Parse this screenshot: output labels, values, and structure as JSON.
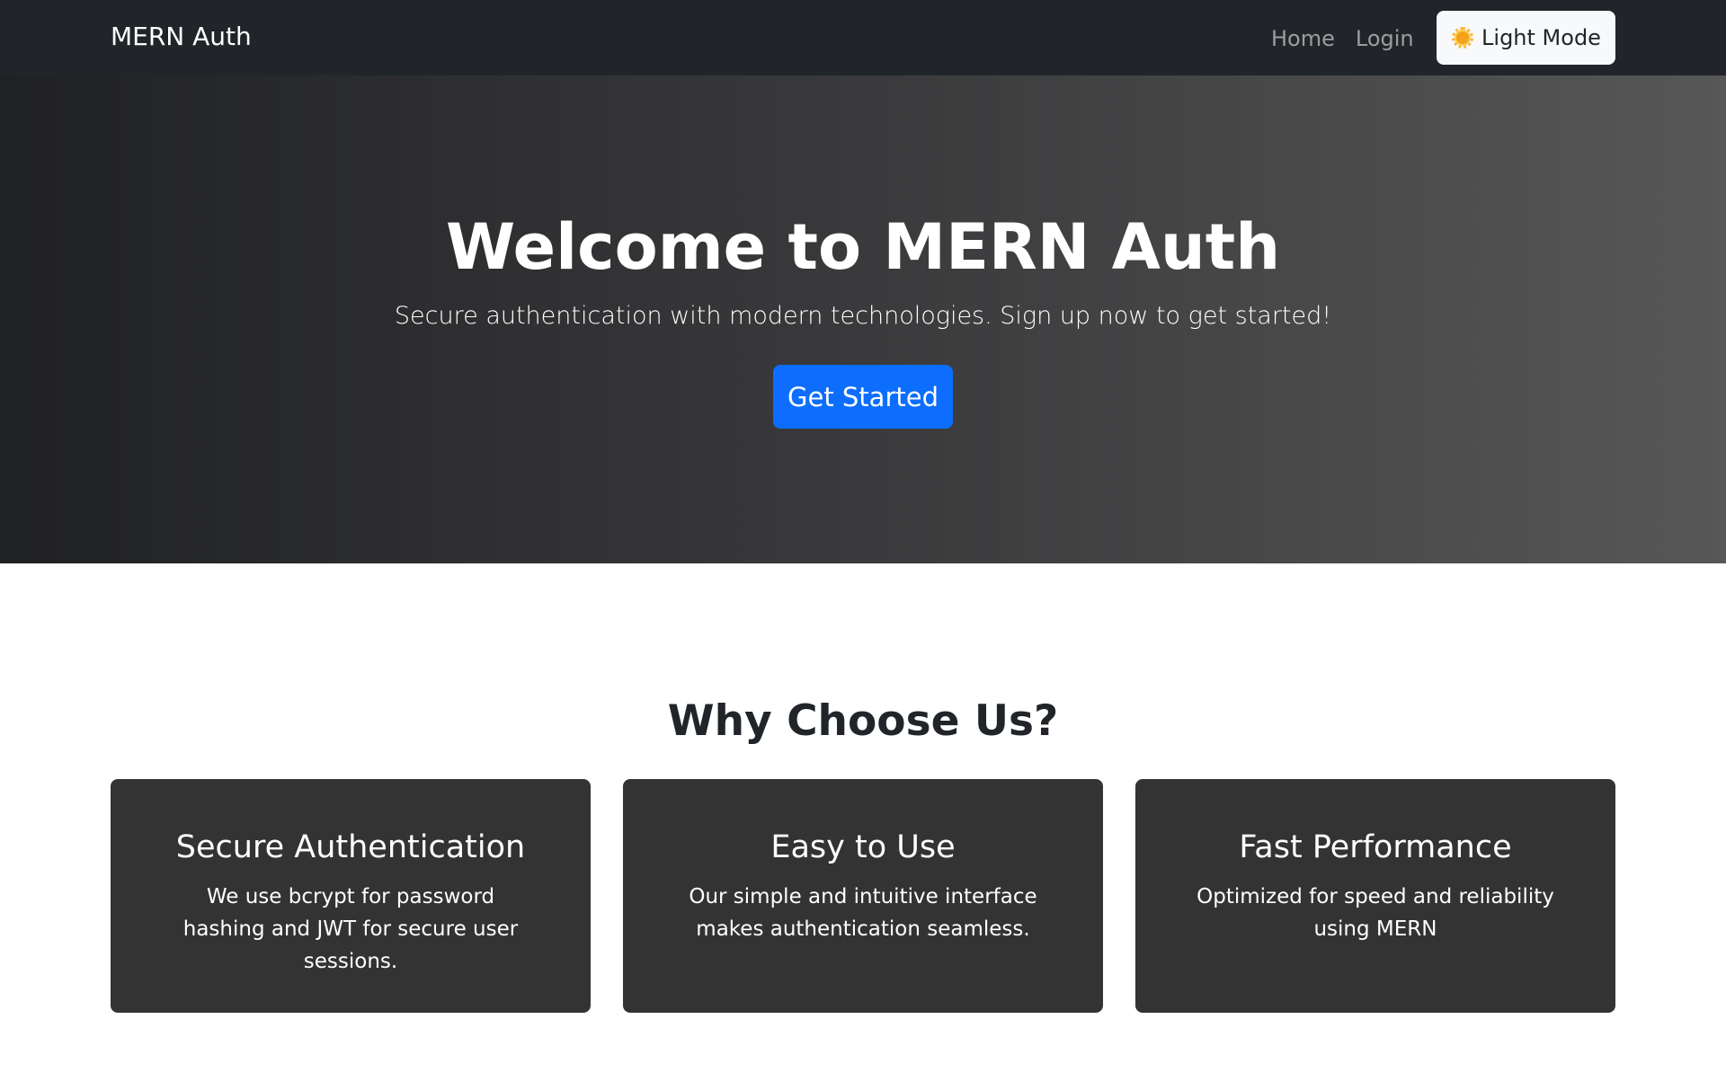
{
  "navbar": {
    "brand": "MERN Auth",
    "links": [
      "Home",
      "Login"
    ],
    "mode_toggle": {
      "label": "Light Mode",
      "icon": "sun-icon"
    }
  },
  "hero": {
    "title": "Welcome to MERN Auth",
    "subtitle": "Secure authentication with modern technologies. Sign up now to get started!",
    "cta_label": "Get Started"
  },
  "features": {
    "heading": "Why Choose Us?",
    "cards": [
      {
        "title": "Secure Authentication",
        "text": "We use bcrypt for password hashing and JWT for secure user sessions."
      },
      {
        "title": "Easy to Use",
        "text": "Our simple and intuitive interface makes authentication seamless."
      },
      {
        "title": "Fast Performance",
        "text": "Optimized for speed and reliability using MERN"
      }
    ]
  },
  "colors": {
    "navbar_bg": "#212529",
    "primary": "#0d6efd",
    "card_bg": "#333333"
  }
}
